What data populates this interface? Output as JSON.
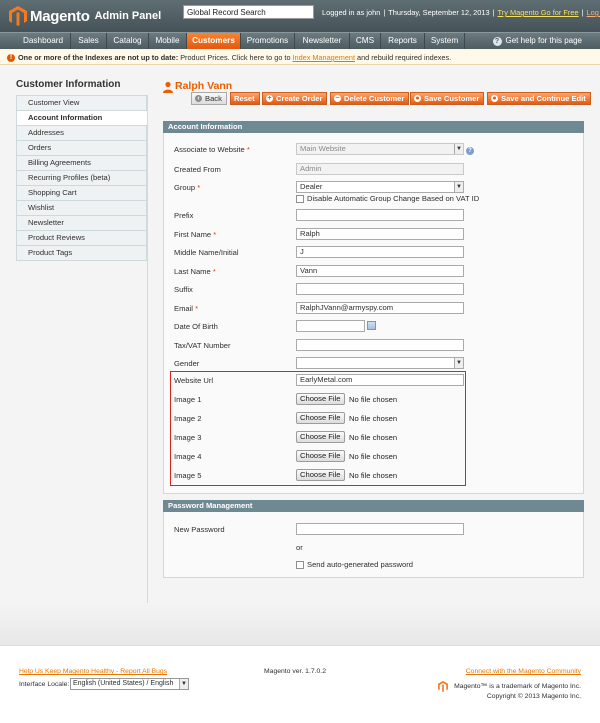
{
  "header": {
    "logo_word": "Magento",
    "logo_sub": "Admin Panel",
    "search_value": "Global Record Search",
    "logged_in": "Logged in as john",
    "date": "Thursday, September 12, 2013",
    "go_free": "Try Magento Go for Free",
    "logout": "Log Out",
    "accent_color": "#e4570f"
  },
  "nav": {
    "items": [
      "Dashboard",
      "Sales",
      "Catalog",
      "Mobile",
      "Customers",
      "Promotions",
      "Newsletter",
      "CMS",
      "Reports",
      "System"
    ],
    "active": "Customers",
    "help": "Get help for this page"
  },
  "notice": {
    "bold": "One or more of the Indexes are not up to date:",
    "text1": "Product Prices. Click here to go to",
    "link": "Index Management",
    "text2": "and rebuild required indexes."
  },
  "sidebar": {
    "title": "Customer Information",
    "items": [
      "Customer View",
      "Account Information",
      "Addresses",
      "Orders",
      "Billing Agreements",
      "Recurring Profiles (beta)",
      "Shopping Cart",
      "Wishlist",
      "Newsletter",
      "Product Reviews",
      "Product Tags"
    ],
    "active": "Account Information"
  },
  "page": {
    "title": "Ralph Vann",
    "buttons": {
      "back": "Back",
      "reset": "Reset",
      "create_order": "Create Order",
      "delete_customer": "Delete Customer",
      "save_customer": "Save Customer",
      "save_continue": "Save and Continue Edit"
    }
  },
  "account": {
    "heading": "Account Information",
    "labels": {
      "website": "Associate to Website",
      "created_from": "Created From",
      "group": "Group",
      "prefix": "Prefix",
      "first_name": "First Name",
      "middle_name": "Middle Name/Initial",
      "last_name": "Last Name",
      "suffix": "Suffix",
      "email": "Email",
      "dob": "Date Of Birth",
      "taxvat": "Tax/VAT Number",
      "gender": "Gender",
      "website_url": "Website Url",
      "image1": "Image 1",
      "image2": "Image 2",
      "image3": "Image 3",
      "image4": "Image 4",
      "image5": "Image 5"
    },
    "required_mark": "*",
    "values": {
      "website": "Main Website",
      "created_from": "Admin",
      "group": "Dealer",
      "prefix": "",
      "first_name": "Ralph",
      "middle_name": "J",
      "last_name": "Vann",
      "suffix": "",
      "email": "RalphJVann@armyspy.com",
      "dob": "",
      "taxvat": "",
      "gender": "",
      "website_url": "EarlyMetal.com"
    },
    "disable_group_change": "Disable Automatic Group Change Based on VAT ID",
    "choose_file": "Choose File",
    "no_file": "No file chosen"
  },
  "password": {
    "heading": "Password Management",
    "new_password_label": "New Password",
    "or": "or",
    "auto_generate": "Send auto-generated password"
  },
  "footer": {
    "help_link": "Help Us Keep Magento Healthy - Report All Bugs",
    "locale_label": "Interface Locale:",
    "locale_value": "English (United States) / English",
    "version": "Magento ver. 1.7.0.2",
    "community": "Connect with the Magento Community",
    "trademark": "Magento™ is a trademark of Magento Inc.",
    "copyright": "Copyright © 2013 Magento Inc."
  }
}
